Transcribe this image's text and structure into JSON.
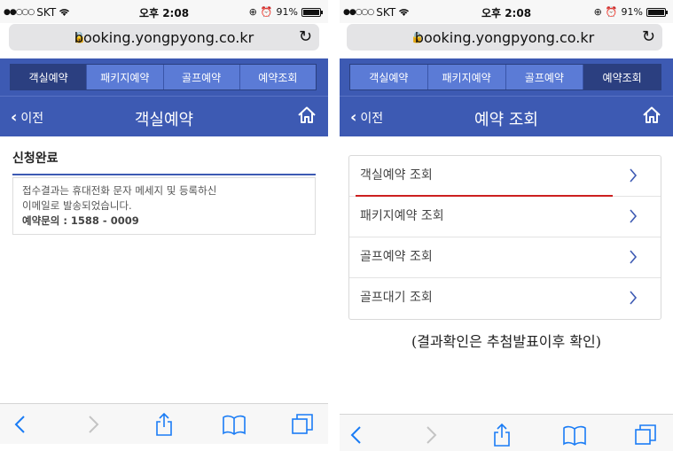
{
  "status": {
    "carrier": "SKT",
    "time": "오후 2:08",
    "battery": "91%",
    "battery_level": 0.91
  },
  "browser": {
    "url": "booking.yongpyong.co.kr"
  },
  "nav_tabs": [
    {
      "label": "객실예약"
    },
    {
      "label": "패키지예약"
    },
    {
      "label": "골프예약"
    },
    {
      "label": "예약조회"
    }
  ],
  "left": {
    "active_tab": 0,
    "back_label": "이전",
    "title": "객실예약",
    "heading": "신청완료",
    "info_line1": "접수결과는 휴대전화 문자 메세지 및 등록하신",
    "info_line2": "이메일로 발송되었습니다.",
    "contact": "예약문의 : 1588 - 0009"
  },
  "right": {
    "active_tab": 3,
    "back_label": "이전",
    "title": "예약 조회",
    "menu": [
      {
        "label": "객실예약 조회"
      },
      {
        "label": "패키지예약 조회"
      },
      {
        "label": "골프예약 조회"
      },
      {
        "label": "골프대기 조회"
      }
    ],
    "note": "(결과확인은 추첨발표이후 확인)"
  },
  "colors": {
    "header_bg": "#3d5ab3",
    "tab_active": "#2b3f80",
    "highlight": "#cc1f1f",
    "ios_blue": "#1a7cf5"
  },
  "icons": [
    "wifi-icon",
    "lock-icon",
    "reload-icon",
    "back-chevron-icon",
    "home-icon",
    "chevron-right-icon",
    "share-icon",
    "bookmarks-icon",
    "tabs-icon",
    "alarm-icon",
    "battery-icon"
  ]
}
